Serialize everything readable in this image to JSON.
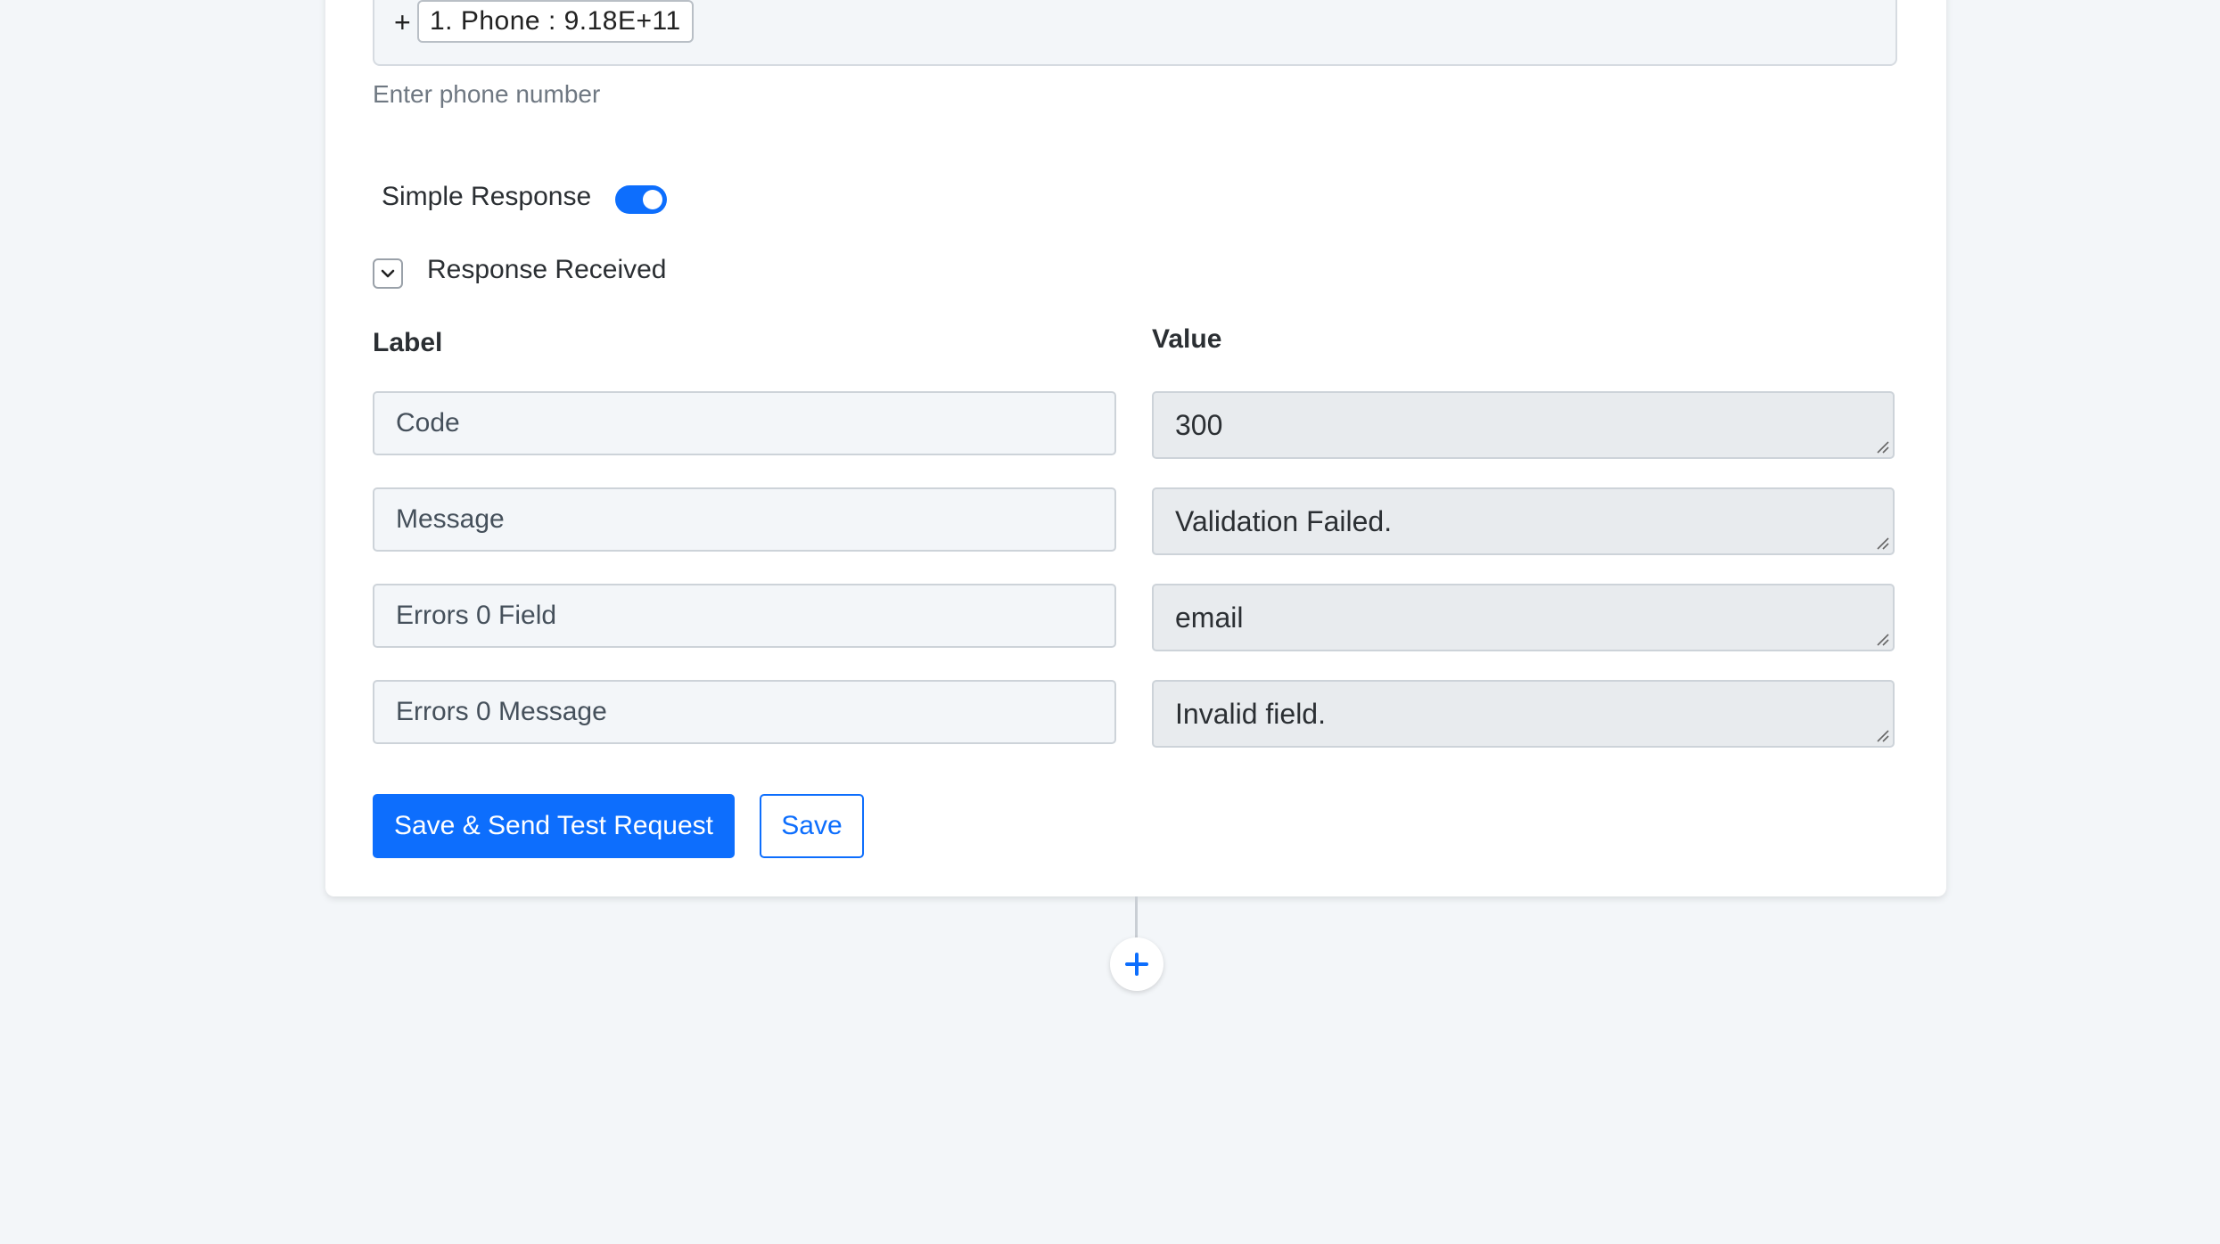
{
  "phone_field": {
    "prefix": "+",
    "chip": "1. Phone : 9.18E+11",
    "helper": "Enter phone number"
  },
  "simple_response": {
    "label": "Simple Response",
    "enabled": true
  },
  "response_received": {
    "label": "Response Received",
    "expanded": true
  },
  "table": {
    "label_header": "Label",
    "value_header": "Value",
    "rows": [
      {
        "label": "Code",
        "value": "300"
      },
      {
        "label": "Message",
        "value": "Validation Failed."
      },
      {
        "label": "Errors 0 Field",
        "value": "email"
      },
      {
        "label": "Errors 0 Message",
        "value": "Invalid field."
      }
    ]
  },
  "actions": {
    "save_send": "Save & Send Test Request",
    "save": "Save"
  },
  "colors": {
    "accent": "#0d6efd",
    "background": "#f3f6f9"
  },
  "icons": {
    "toggle": "toggle-switch-icon",
    "collapse": "chevron-down-icon",
    "add_step": "plus-icon"
  }
}
